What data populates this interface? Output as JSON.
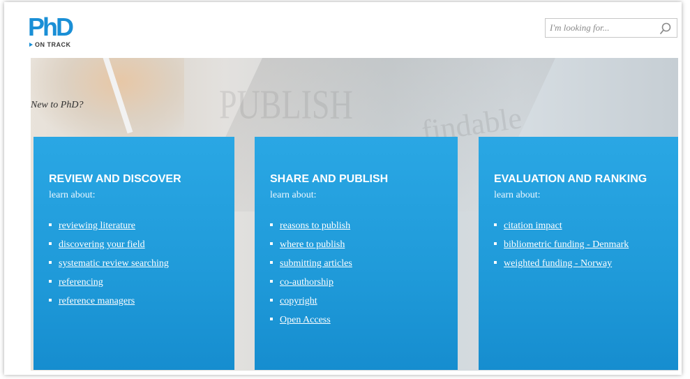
{
  "header": {
    "logo_text": "PhD",
    "logo_subtitle": "ON TRACK",
    "search_placeholder": "I'm looking for..."
  },
  "hero": {
    "tagline": "New to PhD?",
    "watermark_words": [
      "PUBLISH",
      "findable"
    ]
  },
  "panels": [
    {
      "title": "REVIEW AND DISCOVER",
      "subtitle": "learn about:",
      "links": [
        "reviewing literature",
        "discovering your field",
        "systematic review searching",
        "referencing",
        "reference managers"
      ]
    },
    {
      "title": "SHARE AND PUBLISH",
      "subtitle": "learn about:",
      "links": [
        "reasons to publish",
        "where to publish",
        "submitting articles",
        "co-authorship",
        "copyright",
        "Open Access"
      ]
    },
    {
      "title": "EVALUATION AND RANKING",
      "subtitle": "learn about:",
      "links": [
        "citation impact",
        "bibliometric funding - Denmark",
        "weighted funding - Norway"
      ]
    }
  ],
  "colors": {
    "brand_blue": "#1a8fd6",
    "panel_blue": "#1f9ad9",
    "text_white": "#ffffff"
  },
  "icons": [
    "search-icon",
    "arrow-icon"
  ]
}
